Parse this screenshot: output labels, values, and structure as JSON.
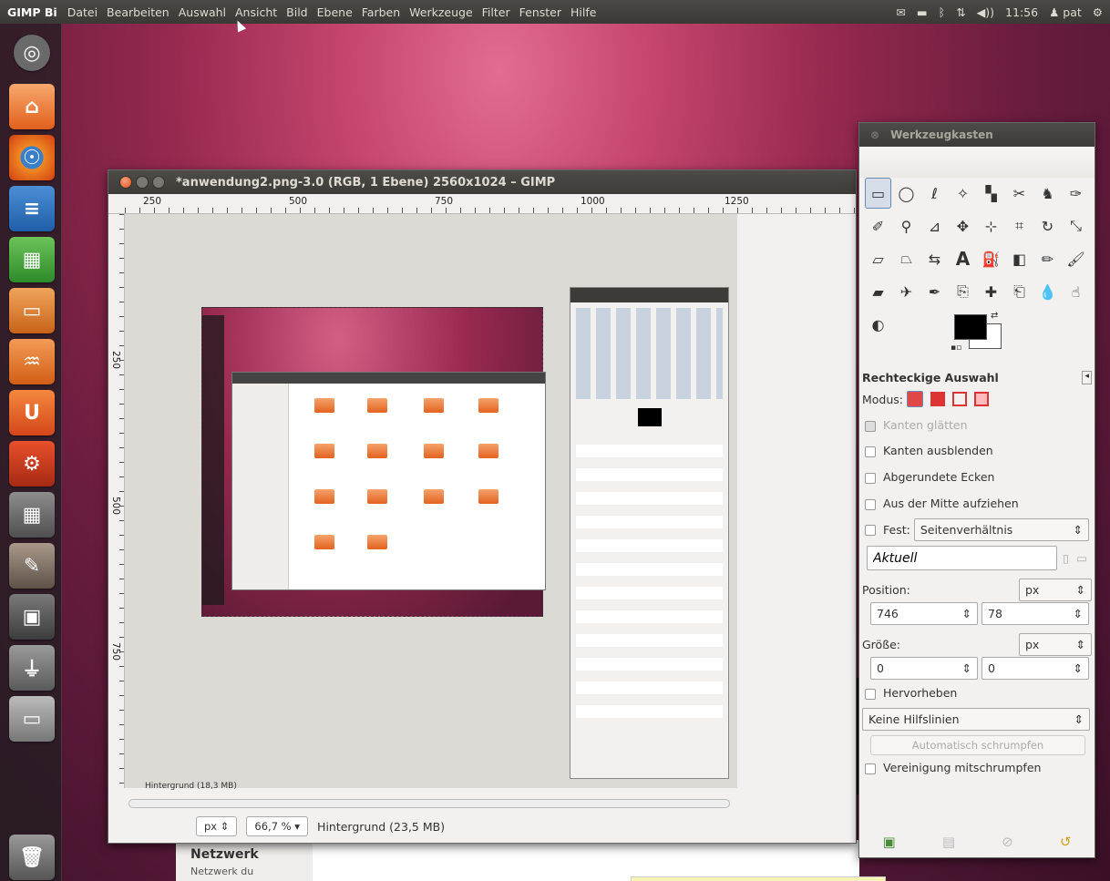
{
  "top_panel": {
    "app_name": "GIMP Bi",
    "menu": [
      "Datei",
      "Bearbeiten",
      "Auswahl",
      "Ansicht",
      "Bild",
      "Ebene",
      "Farben",
      "Werkzeuge",
      "Filter",
      "Fenster",
      "Hilfe"
    ],
    "clock": "11:56",
    "user": "pat",
    "icons": [
      "mail-icon",
      "battery-icon",
      "bluetooth-icon",
      "network-icon",
      "volume-icon",
      "user-icon",
      "gear-icon"
    ]
  },
  "launcher": {
    "items": [
      "dash-icon",
      "home-folder-icon",
      "firefox-icon",
      "writer-icon",
      "calc-icon",
      "impress-icon",
      "software-center-icon",
      "ubuntu-one-icon",
      "system-settings-icon",
      "calculator-icon",
      "gimp-icon",
      "workspace-switcher-icon",
      "usb-drive-icon",
      "disk-drive-icon",
      "trash-icon"
    ]
  },
  "gimp_window": {
    "title": "*anwendung2.png-3.0 (RGB, 1 Ebene) 2560x1024 – GIMP",
    "ruler_h": [
      "250",
      "500",
      "750",
      "1000",
      "1250"
    ],
    "ruler_v": [
      "250",
      "500",
      "750"
    ],
    "status": {
      "unit": "px",
      "zoom": "66,7 %",
      "layer_info": "Hintergrund (23,5 MB)",
      "inner_layer_info": "Hintergrund (18,3 MB)"
    }
  },
  "toolbox": {
    "title": "Werkzeugkasten",
    "tool_options_title": "Rechteckige Auswahl",
    "mode_label": "Modus:",
    "smooth_edges": "Kanten glätten",
    "feather_edges": "Kanten ausblenden",
    "rounded_corners": "Abgerundete Ecken",
    "expand_center": "Aus der Mitte aufziehen",
    "fixed_label": "Fest:",
    "fixed_value": "Seitenverhältnis",
    "current_value": "Aktuell",
    "position_label": "Position:",
    "position_unit": "px",
    "position_x": "746",
    "position_y": "78",
    "size_label": "Größe:",
    "size_unit": "px",
    "size_w": "0",
    "size_h": "0",
    "highlight": "Hervorheben",
    "guides_value": "Keine Hilfslinien",
    "auto_shrink": "Automatisch schrumpfen",
    "shrink_merged": "Vereinigung mitschrumpfen"
  },
  "background_window": {
    "section": "Netzwerk",
    "item": "Netzwerk du"
  }
}
